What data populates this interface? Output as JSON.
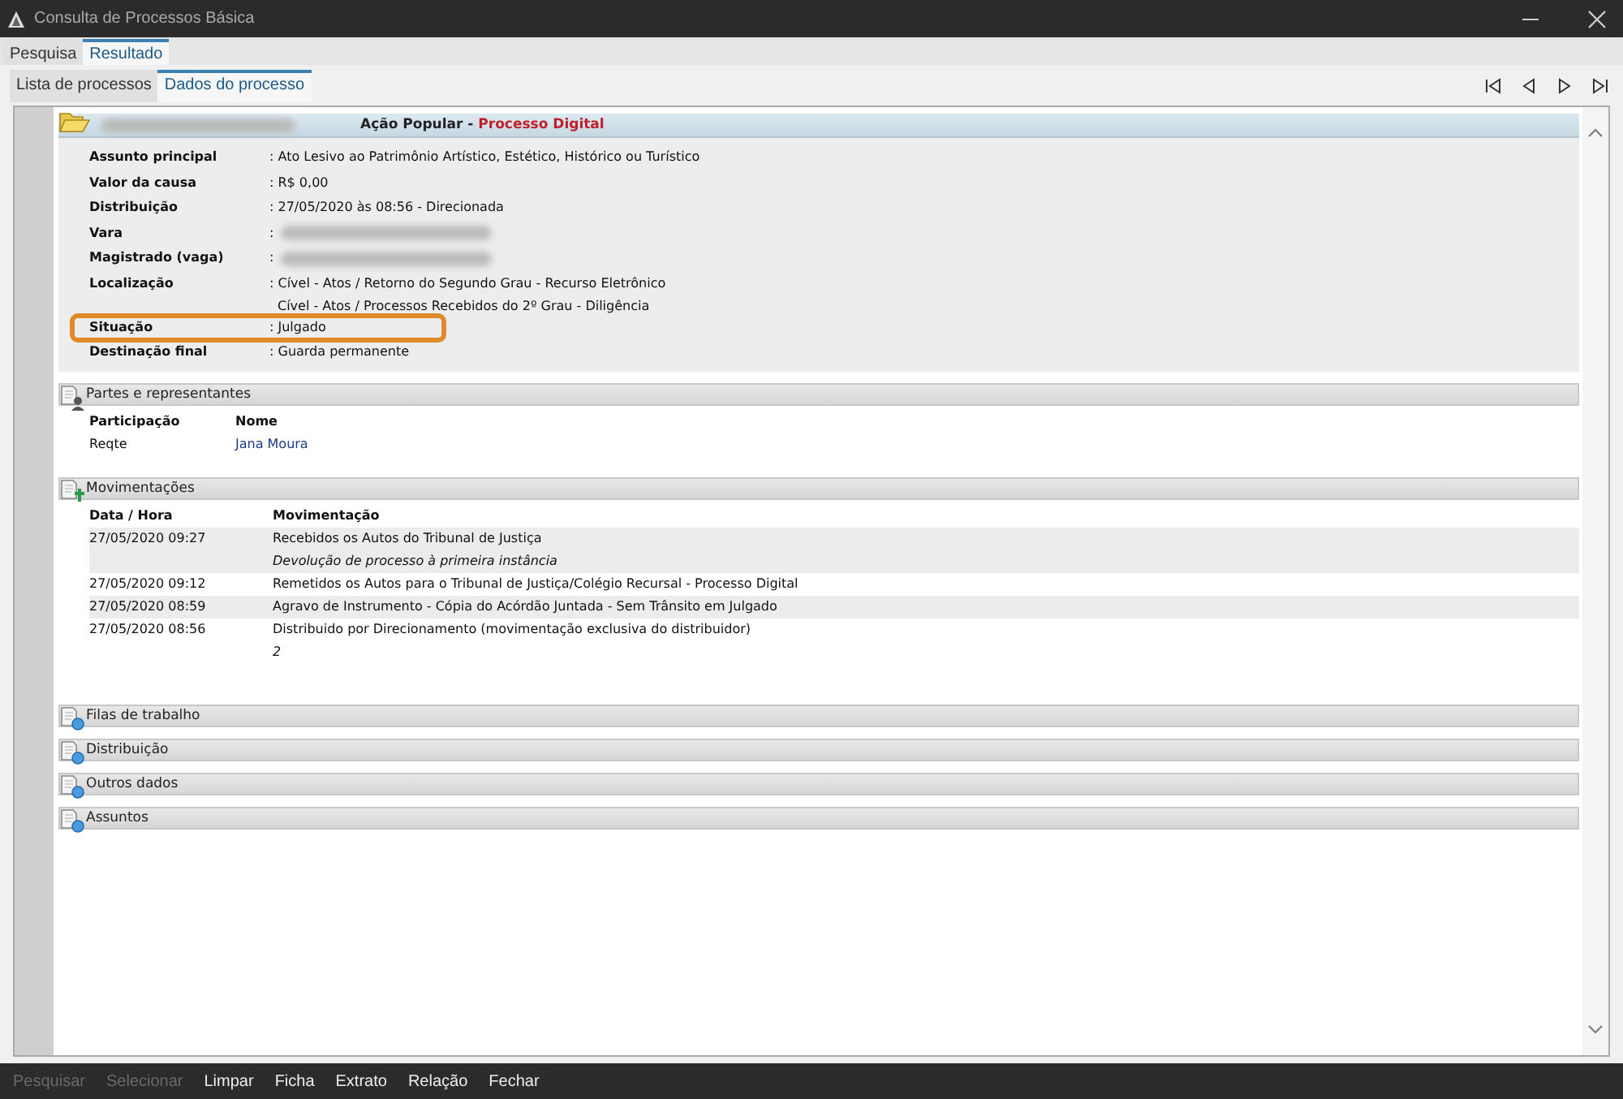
{
  "window": {
    "title": "Consulta de Processos Básica"
  },
  "tabs": [
    {
      "label": "Pesquisa",
      "selected": false
    },
    {
      "label": "Resultado",
      "selected": true
    }
  ],
  "subtabs": [
    {
      "label": "Lista de processos",
      "selected": false
    },
    {
      "label": "Dados do processo",
      "selected": true
    }
  ],
  "process": {
    "number_redacted": true,
    "class": "Ação Popular",
    "separator": "-",
    "type": "Processo Digital",
    "fields": [
      {
        "label": "Assunto principal",
        "lines": [
          ": Ato Lesivo ao Patrimônio Artístico, Estético, Histórico ou Turístico"
        ],
        "highlighted": false
      },
      {
        "label": "Valor da causa",
        "lines": [
          ": R$ 0,00"
        ],
        "highlighted": false
      },
      {
        "label": "Distribuição",
        "lines": [
          ": 27/05/2020 às 08:56 - Direcionada"
        ],
        "highlighted": false
      },
      {
        "label": "Vara",
        "lines": [
          ":"
        ],
        "redacted": true,
        "highlighted": false
      },
      {
        "label": "Magistrado (vaga)",
        "lines": [
          ":"
        ],
        "redacted": true,
        "highlighted": false
      },
      {
        "label": "Localização",
        "lines": [
          ": Cível - Atos / Retorno do Segundo Grau - Recurso Eletrônico",
          "Cível - Atos / Processos Recebidos do 2º Grau - Diligência"
        ],
        "highlighted": false
      },
      {
        "label": "Situação",
        "lines": [
          ": Julgado"
        ],
        "highlighted": true
      },
      {
        "label": "Destinação final",
        "lines": [
          ": Guarda permanente"
        ],
        "highlighted": false
      }
    ]
  },
  "sections": [
    {
      "kind": "parties",
      "title": "Partes e representantes",
      "columns": [
        "Participação",
        "Nome"
      ],
      "rows": [
        {
          "role": "Reqte",
          "name": "Jana Moura"
        }
      ]
    },
    {
      "kind": "movements",
      "title": "Movimentações",
      "columns": [
        "Data / Hora",
        "Movimentação"
      ],
      "rows": [
        {
          "datetime": "27/05/2020 09:27",
          "text": "Recebidos os Autos do Tribunal de Justiça",
          "detail": "Devolução de processo à primeira instância"
        },
        {
          "datetime": "27/05/2020 09:12",
          "text": "Remetidos os Autos para o Tribunal de Justiça/Colégio Recursal - Processo Digital"
        },
        {
          "datetime": "27/05/2020 08:59",
          "text": "Agravo de Instrumento - Cópia do Acórdão Juntada - Sem Trânsito em Julgado"
        },
        {
          "datetime": "27/05/2020 08:56",
          "text": "Distribuido por Direcionamento (movimentação exclusiva do distribuidor)",
          "detail": "2"
        }
      ]
    },
    {
      "kind": "collapsed",
      "title": "Filas de trabalho"
    },
    {
      "kind": "collapsed",
      "title": "Distribuição"
    },
    {
      "kind": "collapsed",
      "title": "Outros dados"
    },
    {
      "kind": "collapsed",
      "title": "Assuntos"
    }
  ],
  "footer_buttons": [
    {
      "label": "Pesquisar",
      "disabled": true
    },
    {
      "label": "Selecionar",
      "disabled": true
    },
    {
      "label": "Limpar",
      "disabled": false
    },
    {
      "label": "Ficha",
      "disabled": false
    },
    {
      "label": "Extrato",
      "disabled": false
    },
    {
      "label": "Relação",
      "disabled": false
    },
    {
      "label": "Fechar",
      "disabled": false
    }
  ]
}
